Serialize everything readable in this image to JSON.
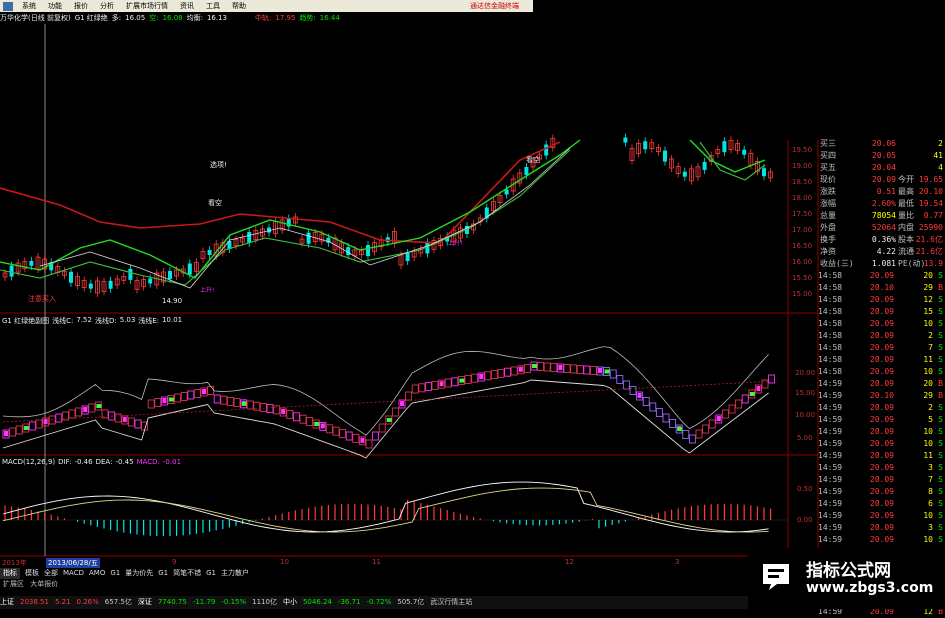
{
  "menu": [
    "系统",
    "功能",
    "报价",
    "分析",
    "扩展市场行情",
    "资讯",
    "工具",
    "帮助"
  ],
  "promo": "通达信金融终端",
  "info": {
    "stock": "万华化学(日线 前复权)",
    "indicator": "G1 红绿绝",
    "duo_label": "多:",
    "duo_val": "16.05",
    "kong_label": "空:",
    "kong_val": "16.08",
    "avg_label": "均衡:",
    "avg_val": "16.13",
    "mid_label": "中轨:",
    "mid_val": "17.95",
    "trend_label": "趋势:",
    "trend_val": "16.44"
  },
  "annotations": {
    "xuanxiang": "选项!",
    "kongkong": "看空",
    "jinbuy": "注意买入",
    "low": "14.90",
    "tag_a": "上升!",
    "tag_b": "看空",
    "tag_c": "上升!"
  },
  "price_axis": [
    "19.50",
    "19.00",
    "18.50",
    "18.00",
    "17.50",
    "17.00",
    "16.50",
    "16.00",
    "15.50",
    "15.00"
  ],
  "sub1": {
    "title": "G1 红绿绝副图",
    "c_label": "浅线C:",
    "c_val": "7.52",
    "d_label": "浅线D:",
    "d_val": "5.03",
    "e_label": "浅线E:",
    "e_val": "10.01",
    "axis": [
      "20.00",
      "15.00",
      "10.00",
      "5.00"
    ]
  },
  "macd": {
    "title": "MACD(12,26,9)",
    "dif_label": "DIF:",
    "dif_val": "-0.46",
    "dea_label": "DEA:",
    "dea_val": "-0.45",
    "macd_label": "MACD:",
    "macd_val": "-0.01",
    "axis": [
      "0.50",
      "0.00"
    ]
  },
  "xaxis": {
    "year": "2013年",
    "date": "2013/06/28/五",
    "months": [
      "9",
      "10",
      "11",
      "12",
      "3"
    ]
  },
  "quote": [
    {
      "k": "买三",
      "v": "20.06",
      "v3": "2",
      "vc": "red"
    },
    {
      "k": "买四",
      "v": "20.05",
      "v3": "41",
      "vc": "red"
    },
    {
      "k": "买五",
      "v": "20.04",
      "v3": "4",
      "vc": "red"
    },
    {
      "k": "现价",
      "v": "20.09",
      "k2": "今开",
      "v3": "19.65",
      "vc": "red"
    },
    {
      "k": "涨跌",
      "v": "0.51",
      "k2": "最高",
      "v3": "20.10",
      "vc": "red"
    },
    {
      "k": "涨幅",
      "v": "2.60%",
      "k2": "最低",
      "v3": "19.54",
      "vc": "red"
    },
    {
      "k": "总量",
      "v": "78054",
      "k2": "量比",
      "v3": "0.77",
      "vc": "yellow"
    },
    {
      "k": "外盘",
      "v": "52064",
      "k2": "内盘",
      "v3": "25990",
      "vc": "red"
    },
    {
      "k": "换手",
      "v": "0.36%",
      "k2": "股本",
      "v3": "21.6亿",
      "vc": "white"
    },
    {
      "k": "净资",
      "v": "4.22",
      "k2": "流通",
      "v3": "21.6亿",
      "vc": "white"
    },
    {
      "k": "收益(三)",
      "v": "1.081",
      "k2": "PE(动)",
      "v3": "13.9",
      "vc": "white"
    }
  ],
  "ticks": [
    {
      "t": "14:58",
      "p": "20.09",
      "q": "20",
      "s": "S"
    },
    {
      "t": "14:58",
      "p": "20.10",
      "q": "29",
      "s": "B"
    },
    {
      "t": "14:58",
      "p": "20.09",
      "q": "12",
      "s": "S"
    },
    {
      "t": "14:58",
      "p": "20.09",
      "q": "15",
      "s": "S"
    },
    {
      "t": "14:58",
      "p": "20.09",
      "q": "10",
      "s": "S"
    },
    {
      "t": "14:58",
      "p": "20.09",
      "q": "2",
      "s": "S"
    },
    {
      "t": "14:58",
      "p": "20.09",
      "q": "7",
      "s": "S"
    },
    {
      "t": "14:58",
      "p": "20.09",
      "q": "11",
      "s": "S"
    },
    {
      "t": "14:58",
      "p": "20.09",
      "q": "10",
      "s": "S"
    },
    {
      "t": "14:59",
      "p": "20.09",
      "q": "20",
      "s": "B"
    },
    {
      "t": "14:59",
      "p": "20.10",
      "q": "29",
      "s": "B"
    },
    {
      "t": "14:59",
      "p": "20.09",
      "q": "2",
      "s": "S"
    },
    {
      "t": "14:59",
      "p": "20.09",
      "q": "5",
      "s": "S"
    },
    {
      "t": "14:59",
      "p": "20.09",
      "q": "10",
      "s": "S"
    },
    {
      "t": "14:59",
      "p": "20.09",
      "q": "10",
      "s": "S"
    },
    {
      "t": "14:59",
      "p": "20.09",
      "q": "11",
      "s": "S"
    },
    {
      "t": "14:59",
      "p": "20.09",
      "q": "3",
      "s": "S"
    },
    {
      "t": "14:59",
      "p": "20.09",
      "q": "7",
      "s": "S"
    },
    {
      "t": "14:59",
      "p": "20.09",
      "q": "8",
      "s": "S"
    },
    {
      "t": "14:59",
      "p": "20.09",
      "q": "6",
      "s": "S"
    },
    {
      "t": "14:59",
      "p": "20.09",
      "q": "10",
      "s": "S"
    },
    {
      "t": "14:59",
      "p": "20.09",
      "q": "3",
      "s": "S"
    },
    {
      "t": "14:59",
      "p": "20.09",
      "q": "10",
      "s": "S"
    },
    {
      "t": "14:59",
      "p": "20.09",
      "q": "18",
      "s": "S"
    },
    {
      "t": "14:59",
      "p": "20.09",
      "q": "16",
      "s": "S"
    },
    {
      "t": "14:59",
      "p": "20.09",
      "q": "10",
      "s": "S"
    },
    {
      "t": "14:59",
      "p": "20.09",
      "q": "20",
      "s": "S"
    },
    {
      "t": "14:59",
      "p": "20.09",
      "q": "35",
      "s": "S"
    },
    {
      "t": "14:59",
      "p": "20.09",
      "q": "12",
      "s": "B"
    }
  ],
  "tabs": [
    "指标",
    "模板",
    "全部",
    "MACD",
    "AMO",
    "G1",
    "量为价先",
    "G1",
    "简笔不错",
    "G1",
    "主力散户"
  ],
  "bottom": {
    "a": "扩展区",
    "b": "大单报价"
  },
  "status": [
    {
      "label": "上证",
      "val": "2038.51",
      "chg": "5.21",
      "pct": "0.26%",
      "amt": "657.5亿"
    },
    {
      "label": "深证",
      "val": "7740.75",
      "chg": "-11.79",
      "pct": "-0.15%",
      "amt": "1110亿"
    },
    {
      "label": "中小",
      "val": "5046.24",
      "chg": "-36.71",
      "pct": "-0.72%",
      "amt": "505.7亿"
    }
  ],
  "status_tail": "武汉行情主站",
  "watermark": {
    "line1": "指标公式网",
    "line2": "www.zbgs3.com"
  },
  "colors": {
    "up": "#ff3b3b",
    "down": "#00e5e5",
    "ma_green": "#22dd22",
    "ma_red": "#c81818",
    "ma_white": "#dddddd",
    "magenta": "#ff33ff",
    "purple": "#9966ff"
  }
}
